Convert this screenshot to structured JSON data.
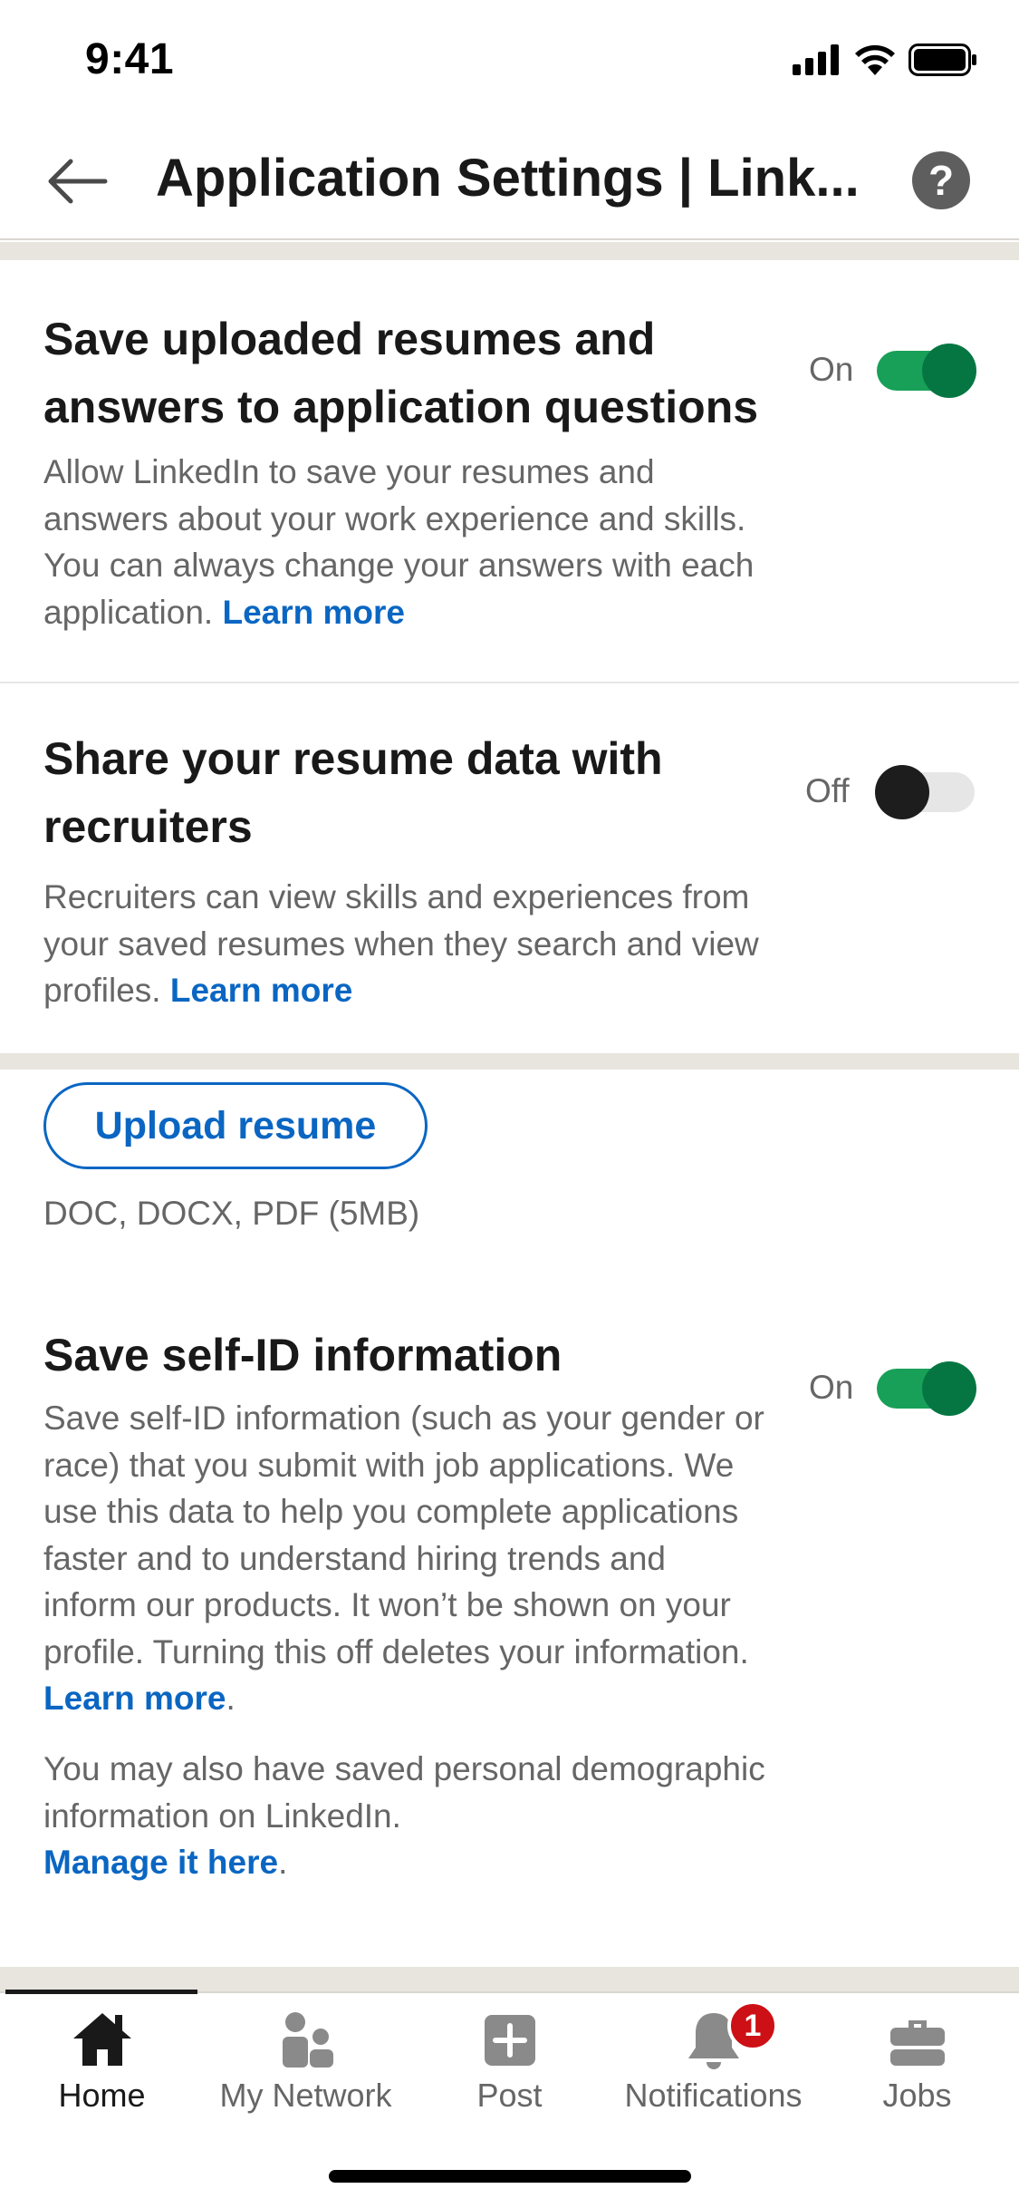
{
  "status_bar": {
    "time": "9:41"
  },
  "header": {
    "title": "Application Settings | Link...",
    "help_label": "?"
  },
  "settings": [
    {
      "title": "Save uploaded resumes and answers to application questions",
      "description": "Allow LinkedIn to save your resumes and answers about your work experience and skills. You can always change your answers with each application.",
      "link": "Learn more",
      "toggle_label": "On",
      "enabled": true
    },
    {
      "title": "Share your resume data with recruiters",
      "description": "Recruiters can view skills and experiences from your saved resumes when they search and view profiles.",
      "link": "Learn more",
      "toggle_label": "Off",
      "enabled": false
    },
    {
      "title": "Save self-ID information",
      "description": "Save self-ID information (such as your gender or race) that you submit with job applications. We use this data to help you complete applications faster and to understand hiring trends and inform our products. It won’t be shown on your profile. Turning this off deletes your information.",
      "link": "Learn more",
      "link_suffix": ".",
      "extra_text": "You may also have saved personal demographic information on LinkedIn.",
      "extra_link": "Manage it here",
      "extra_suffix": ".",
      "toggle_label": "On",
      "enabled": true
    }
  ],
  "upload": {
    "button_label": "Upload resume",
    "hint": "DOC, DOCX, PDF (5MB)"
  },
  "bottom_nav": {
    "items": [
      {
        "label": "Home",
        "icon": "home-icon",
        "active": true
      },
      {
        "label": "My Network",
        "icon": "network-icon",
        "active": false
      },
      {
        "label": "Post",
        "icon": "post-icon",
        "active": false
      },
      {
        "label": "Notifications",
        "icon": "bell-icon",
        "active": false,
        "badge": "1"
      },
      {
        "label": "Jobs",
        "icon": "briefcase-icon",
        "active": false
      }
    ]
  },
  "colors": {
    "accent": "#0a66c2",
    "toggle_on": "#057642",
    "badge": "#cc1016"
  }
}
